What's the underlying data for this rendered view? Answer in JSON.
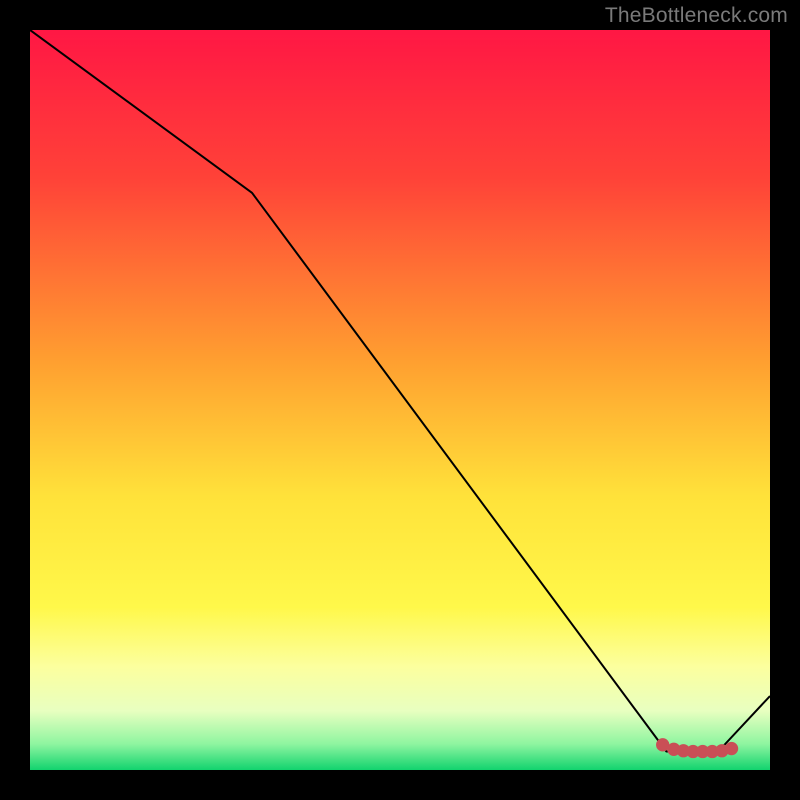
{
  "watermark": "TheBottleneck.com",
  "chart_data": {
    "type": "line",
    "title": "",
    "xlabel": "",
    "ylabel": "",
    "xlim": [
      0,
      100
    ],
    "ylim": [
      0,
      100
    ],
    "gradient_stops": [
      {
        "offset": 0,
        "color": "#ff1744"
      },
      {
        "offset": 0.2,
        "color": "#ff4238"
      },
      {
        "offset": 0.45,
        "color": "#ffa030"
      },
      {
        "offset": 0.63,
        "color": "#ffe23a"
      },
      {
        "offset": 0.78,
        "color": "#fff84a"
      },
      {
        "offset": 0.86,
        "color": "#fcff9e"
      },
      {
        "offset": 0.92,
        "color": "#e8ffc0"
      },
      {
        "offset": 0.965,
        "color": "#8ef5a0"
      },
      {
        "offset": 1.0,
        "color": "#12d36e"
      }
    ],
    "series": [
      {
        "name": "bottleneck-curve",
        "x": [
          0,
          30,
          86,
          93,
          100
        ],
        "values": [
          100,
          78,
          2.5,
          2.5,
          10
        ],
        "stroke": "#000000",
        "stroke_width": 2
      }
    ],
    "markers": {
      "name": "optimal-zone",
      "color": "#c94f56",
      "points": [
        {
          "x": 85.5,
          "y": 3.4
        },
        {
          "x": 87.0,
          "y": 2.8
        },
        {
          "x": 88.3,
          "y": 2.6
        },
        {
          "x": 89.6,
          "y": 2.5
        },
        {
          "x": 90.9,
          "y": 2.5
        },
        {
          "x": 92.2,
          "y": 2.5
        },
        {
          "x": 93.5,
          "y": 2.6
        },
        {
          "x": 94.8,
          "y": 2.9
        }
      ],
      "radius_data_units": 0.9
    }
  }
}
